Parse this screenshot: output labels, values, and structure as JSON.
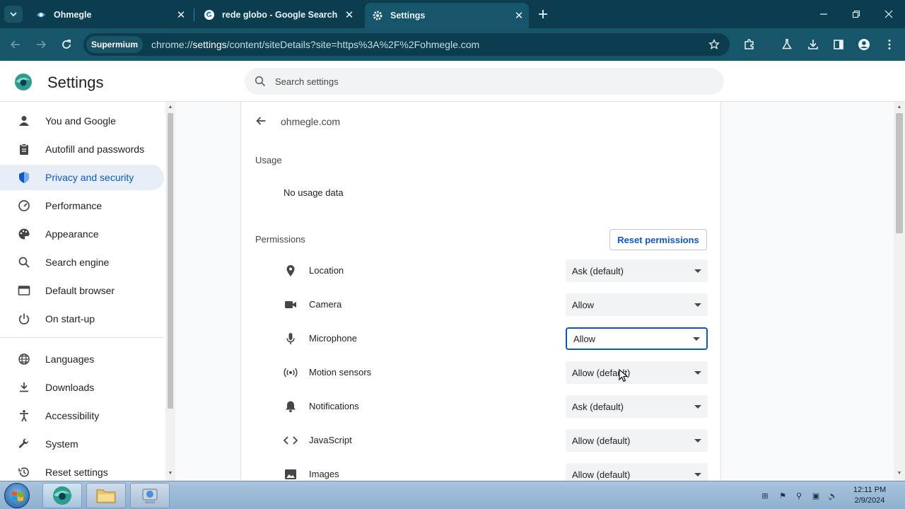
{
  "tabs": [
    {
      "title": "Ohmegle",
      "favicon": "ohmegle-icon"
    },
    {
      "title": "rede globo - Google Search",
      "favicon": "google-icon"
    },
    {
      "title": "Settings",
      "favicon": "settings-gear-icon",
      "active": true
    }
  ],
  "toolbar": {
    "browser_chip": "Supermium",
    "url_prefix": "chrome://",
    "url_host": "settings",
    "url_rest": "/content/siteDetails?site=https%3A%2F%2Fohmegle.com"
  },
  "header": {
    "title": "Settings",
    "search_placeholder": "Search settings"
  },
  "sidebar": {
    "items": [
      {
        "label": "You and Google",
        "icon": "person-icon"
      },
      {
        "label": "Autofill and passwords",
        "icon": "clipboard-icon"
      },
      {
        "label": "Privacy and security",
        "icon": "shield-icon",
        "active": true
      },
      {
        "label": "Performance",
        "icon": "speedometer-icon"
      },
      {
        "label": "Appearance",
        "icon": "palette-icon"
      },
      {
        "label": "Search engine",
        "icon": "search-icon"
      },
      {
        "label": "Default browser",
        "icon": "browser-icon"
      },
      {
        "label": "On start-up",
        "icon": "power-icon"
      },
      {
        "label": "Languages",
        "icon": "globe-icon"
      },
      {
        "label": "Downloads",
        "icon": "download-icon"
      },
      {
        "label": "Accessibility",
        "icon": "accessibility-icon"
      },
      {
        "label": "System",
        "icon": "wrench-icon"
      },
      {
        "label": "Reset settings",
        "icon": "history-icon"
      }
    ]
  },
  "site_details": {
    "site": "ohmegle.com",
    "usage_label": "Usage",
    "usage_value": "No usage data",
    "permissions_label": "Permissions",
    "reset_button": "Reset permissions",
    "permissions": [
      {
        "label": "Location",
        "value": "Ask (default)",
        "icon": "location-pin-icon"
      },
      {
        "label": "Camera",
        "value": "Allow",
        "icon": "camera-icon"
      },
      {
        "label": "Microphone",
        "value": "Allow",
        "icon": "microphone-icon",
        "focused": true
      },
      {
        "label": "Motion sensors",
        "value": "Allow (default)",
        "icon": "motion-sensor-icon"
      },
      {
        "label": "Notifications",
        "value": "Ask (default)",
        "icon": "bell-icon"
      },
      {
        "label": "JavaScript",
        "value": "Allow (default)",
        "icon": "code-icon"
      },
      {
        "label": "Images",
        "value": "Allow (default)",
        "icon": "image-icon"
      }
    ]
  },
  "taskbar": {
    "time": "12:11 PM",
    "date": "2/9/2024"
  },
  "colors": {
    "tabstrip": "#0b3d4f",
    "toolbar": "#17566a",
    "accent": "#0b57d0",
    "active_nav_bg": "#e8eef7"
  }
}
